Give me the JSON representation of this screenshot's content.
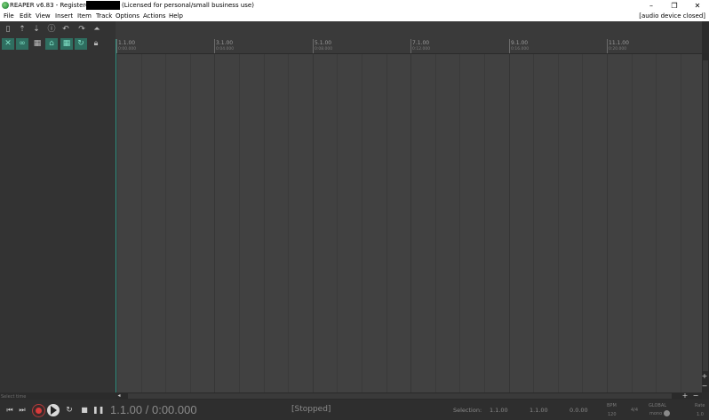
{
  "window": {
    "title_prefix": "REAPER v6.83 - Registered to",
    "title_suffix": "(Licensed for personal/small business use)",
    "minimize": "–",
    "restore": "❐",
    "close": "✕"
  },
  "menu": {
    "items": [
      "File",
      "Edit",
      "View",
      "Insert",
      "Item",
      "Track",
      "Options",
      "Actions",
      "Help"
    ],
    "audio_status": "[audio device closed]"
  },
  "ruler": {
    "markers": [
      {
        "label": "1.1.00",
        "time": "0:00.000"
      },
      {
        "label": "3.1.00",
        "time": "0:04.000"
      },
      {
        "label": "5.1.00",
        "time": "0:08.000"
      },
      {
        "label": "7.1.00",
        "time": "0:12.000"
      },
      {
        "label": "9.1.00",
        "time": "0:16.000"
      },
      {
        "label": "11.1.00",
        "time": "0:20.000"
      }
    ]
  },
  "status_hint": "Select time",
  "transport": {
    "position": "1.1.00 / 0:00.000",
    "state": "[Stopped]",
    "selection_label": "Selection:",
    "selection_start": "1.1.00",
    "selection_end": "1.1.00",
    "selection_length": "0.0.00",
    "bpm_label": "BPM",
    "bpm_value": "120",
    "time_signature": "4/4",
    "global_label": "GLOBAL",
    "mono_label": "mono",
    "rate_label": "Rate",
    "rate_value": "1.0"
  },
  "icons": {
    "toolbar_row1": [
      "new-project-icon",
      "open-project-icon",
      "save-project-icon",
      "project-settings-icon",
      "undo-icon",
      "redo-icon",
      "metronome-icon"
    ],
    "toolbar_row2": [
      "auto-crossfade-icon",
      "ripple-edit-icon",
      "grid-icon",
      "envelope-lock-icon",
      "snap-icon",
      "loop-icon",
      "lock-icon"
    ]
  },
  "colors": {
    "accent_teal": "#2f6e60",
    "record_red": "#d83a3a"
  }
}
